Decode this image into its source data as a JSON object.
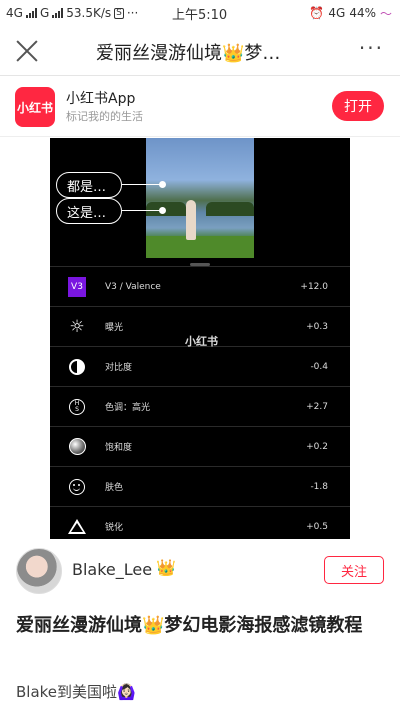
{
  "status_bar": {
    "net1": "4G",
    "net2": "G",
    "speed": "53.5K/s",
    "sim_icon": "S",
    "dots": "···",
    "time": "上午5:10",
    "alarm_icon": "alarm-clock-icon",
    "net3": "4G",
    "battery": "44%",
    "wave_icon": "signal-wave-icon"
  },
  "header": {
    "title": "爱丽丝漫游仙境👑梦…",
    "more": "···"
  },
  "app_banner": {
    "logo_text": "小红书",
    "name": "小红书App",
    "tagline": "标记我的的生活",
    "open_button": "打开"
  },
  "image": {
    "bubble_1": "都是…",
    "bubble_2": "这是…",
    "watermark": "小红书",
    "adjustments": [
      {
        "icon": "v3-filter-icon",
        "icon_text": "V3",
        "label": "V3 / Valence",
        "value": "+12.0"
      },
      {
        "icon": "exposure-icon",
        "label": "曝光",
        "value": "+0.3"
      },
      {
        "icon": "contrast-icon",
        "label": "对比度",
        "value": "-0.4"
      },
      {
        "icon": "hsl-icon",
        "label": "色调：高光",
        "value": "+2.7"
      },
      {
        "icon": "saturation-icon",
        "label": "饱和度",
        "value": "+0.2"
      },
      {
        "icon": "skin-tone-icon",
        "label": "肤色",
        "value": "-1.8"
      },
      {
        "icon": "sharpen-icon",
        "label": "锐化",
        "value": "+0.5"
      }
    ]
  },
  "author": {
    "name": "Blake_Lee",
    "badge": "👑",
    "follow_button": "关注"
  },
  "post": {
    "title": "爱丽丝漫游仙境👑梦幻电影海报感滤镜教程",
    "description": "Blake到美国啦🙆🏻‍♀️"
  },
  "colors": {
    "brand_red": "#ff2741",
    "v3_purple": "#7a16e0"
  }
}
